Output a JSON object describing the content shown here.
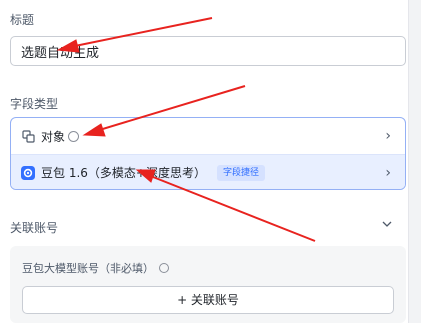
{
  "title_section": {
    "label": "标题",
    "input_value": "选题自动生成"
  },
  "field_type_section": {
    "label": "字段类型",
    "option_object": {
      "label": "对象"
    },
    "option_model": {
      "label": "豆包 1.6（多模态+深度思考）",
      "badge": "字段捷径"
    }
  },
  "linked_account_section": {
    "label": "关联账号",
    "account_label": "豆包大模型账号（非必填）",
    "link_button_label": "+ 关联账号"
  },
  "colors": {
    "accent": "#3370ff",
    "annotation_arrow": "#e8231f",
    "selected_row_bg": "#e8efff"
  }
}
